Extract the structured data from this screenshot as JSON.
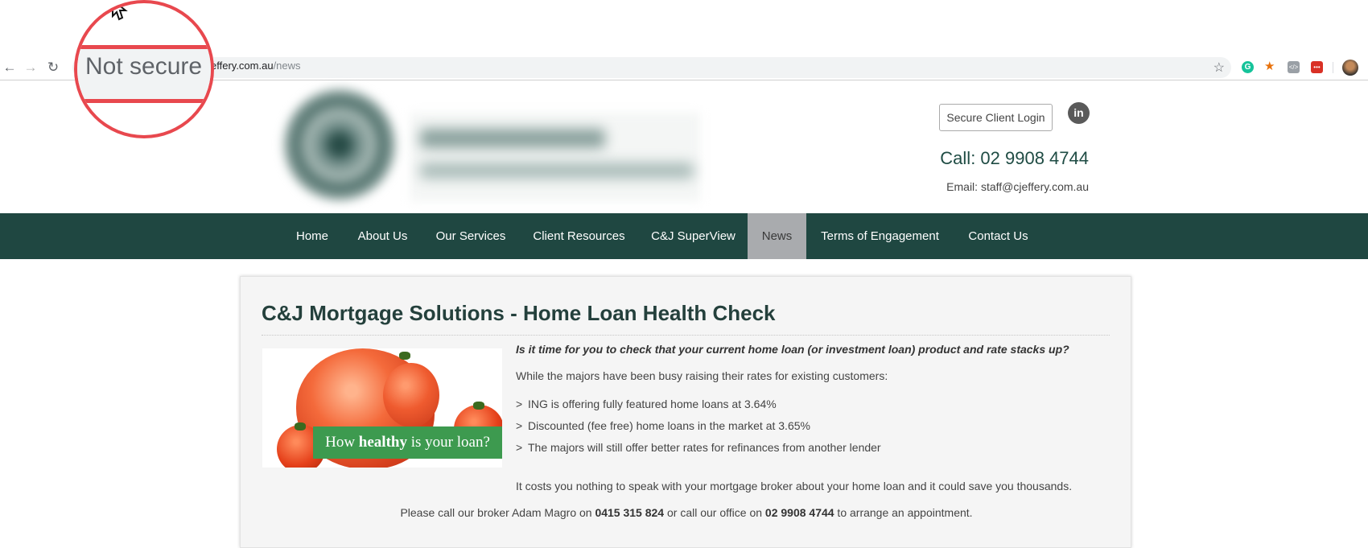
{
  "browser": {
    "url_host": "effery.com.au",
    "url_path": "/news",
    "magnifier_text": "Not secure"
  },
  "header": {
    "login_button": "Secure Client Login",
    "phone": "Call: 02 9908 4744",
    "email": "Email: staff@cjeffery.com.au"
  },
  "nav": {
    "items": [
      {
        "label": "Home"
      },
      {
        "label": "About Us"
      },
      {
        "label": "Our Services"
      },
      {
        "label": "Client Resources"
      },
      {
        "label": "C&J SuperView"
      },
      {
        "label": "News",
        "active": true
      },
      {
        "label": "Terms of Engagement"
      },
      {
        "label": "Contact Us"
      }
    ]
  },
  "article": {
    "title": "C&J Mortgage Solutions - Home Loan Health Check",
    "image_caption_pre": "How ",
    "image_caption_bold": "healthy",
    "image_caption_post": " is your loan?",
    "question": "Is it time for you to check that your current home loan (or investment loan) product and rate stacks up?",
    "intro": "While the majors have been busy raising their rates for existing customers:",
    "bullets": [
      "ING is offering fully featured home loans at 3.64%",
      "Discounted (fee free) home loans in the market at 3.65%",
      "The majors will still offer better rates for refinances from another lender"
    ],
    "bullet_marker": ">",
    "closing": "It costs you nothing to speak with your mortgage broker about your home loan and it could save you thousands.",
    "cta_pre": "Please call our broker Adam Magro on ",
    "cta_mobile": "0415 315 824",
    "cta_mid": " or call our office on ",
    "cta_office": "02 9908 4744",
    "cta_post": " to arrange an appointment."
  },
  "colors": {
    "nav_bg": "#1f4741",
    "nav_active_bg": "#a9abae",
    "heading": "#24403c",
    "promo_green": "#3d9a4f",
    "magnifier_red": "#e8484e"
  }
}
